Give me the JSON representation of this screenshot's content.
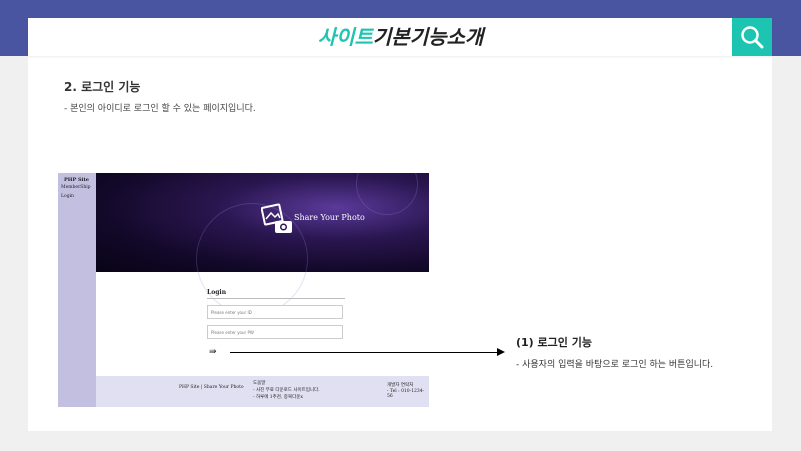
{
  "header": {
    "title_accent": "사이트",
    "title_rest": "기본기능소개",
    "search_icon": "search-icon",
    "accent_color": "#1cc4b1",
    "band_color": "#4a55a2"
  },
  "section": {
    "heading": "2. 로그인 기능",
    "description": "-  본인의 아이디로 로그인 할 수 있는 페이지입니다."
  },
  "screenshot": {
    "sidebar": {
      "title": "PHP Site",
      "items": [
        "MemberShip",
        "Login"
      ]
    },
    "hero_text": "Share Your Photo",
    "login": {
      "title": "Login",
      "id_placeholder": "Please enter your ID",
      "pw_placeholder": "Please enter your PW",
      "submit_glyph": "⇛"
    },
    "footer": {
      "brand": "PHP Site | Share Your Photo",
      "guide_title": "도움말",
      "guide_line1": "- 사진 무료 다운로드 사이트입니다.",
      "guide_line2": "- 하루에 1추천, 중복다운x",
      "contact_title": "개발자 연락처",
      "contact_tel": "- Tel : 010-1234-56"
    }
  },
  "annotation": {
    "title": "(1) 로그인 기능",
    "description": "-  사용자의 입력을 바탕으로 로그인 하는 버튼입니다."
  }
}
